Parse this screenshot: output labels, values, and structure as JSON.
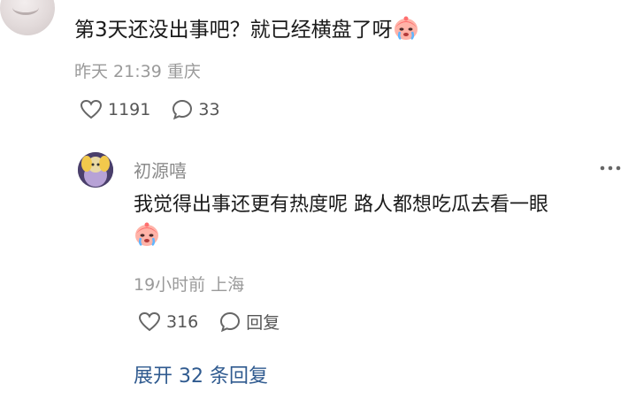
{
  "top_comment": {
    "text": "第3天还没出事吧？就已经横盘了呀",
    "emoji": "crying-face-emoji",
    "time": "昨天 21:39",
    "location": "重庆",
    "likes": "1191",
    "replies": "33"
  },
  "reply": {
    "username": "初源嘻",
    "text": "我觉得出事还更有热度呢 路人都想吃瓜去看一眼",
    "emoji": "crying-face-emoji",
    "time": "19小时前",
    "location": "上海",
    "likes": "316",
    "reply_label": "回复"
  },
  "expand": {
    "label": "展开 32 条回复"
  },
  "colors": {
    "text": "#1a1a1a",
    "meta": "#9a9a9a",
    "link": "#2f5a8f"
  }
}
